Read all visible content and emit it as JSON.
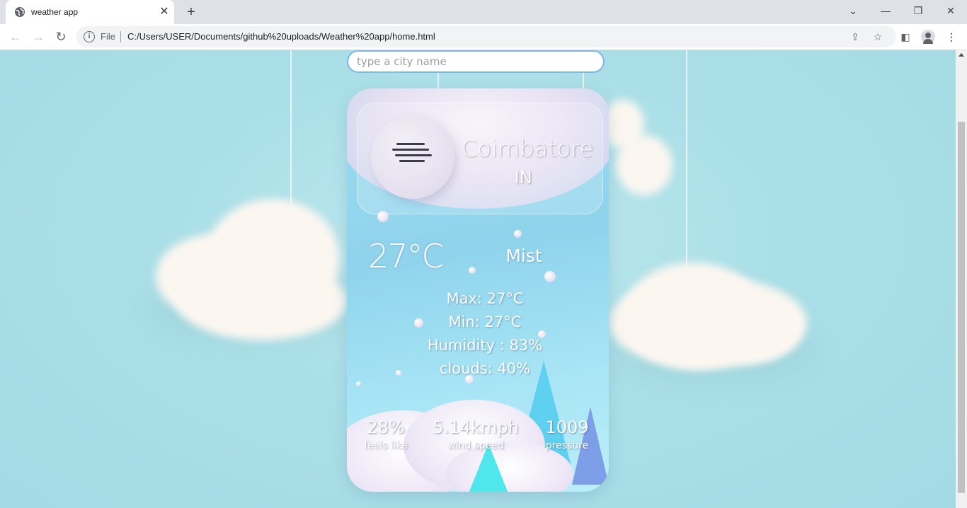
{
  "browser": {
    "tab_title": "weather app",
    "tab_close": "✕",
    "new_tab": "+",
    "address_label": "File",
    "url": "C:/Users/USER/Documents/github%20uploads/Weather%20app/home.html",
    "window_controls": {
      "dropdown": "⌄",
      "minimize": "—",
      "restore": "❐",
      "close": "✕"
    },
    "icons": [
      "globe-icon",
      "back-icon",
      "forward-icon",
      "reload-icon",
      "info-icon",
      "share-icon",
      "star-icon",
      "sidebar-icon",
      "profile-icon",
      "menu-icon"
    ]
  },
  "search": {
    "placeholder": "type a city name",
    "value": ""
  },
  "weather": {
    "city": "Coimbatore",
    "country": "IN",
    "icon": "mist-icon",
    "temperature": "27°C",
    "condition": "Mist",
    "max": "Max: 27°C",
    "min": "Min: 27°C",
    "humidity": "Humidity : 83%",
    "clouds": "clouds: 40%",
    "feels_like_value": "28%",
    "feels_like_label": "feels like",
    "wind_value": "5.14kmph",
    "wind_label": "wind speed",
    "pressure_value": "1009",
    "pressure_label": "pressure"
  },
  "colors": {
    "sky": "#a4dae3",
    "card": "#8fd3ec",
    "search_border": "#7fb6e8",
    "text": "#ffffff"
  }
}
